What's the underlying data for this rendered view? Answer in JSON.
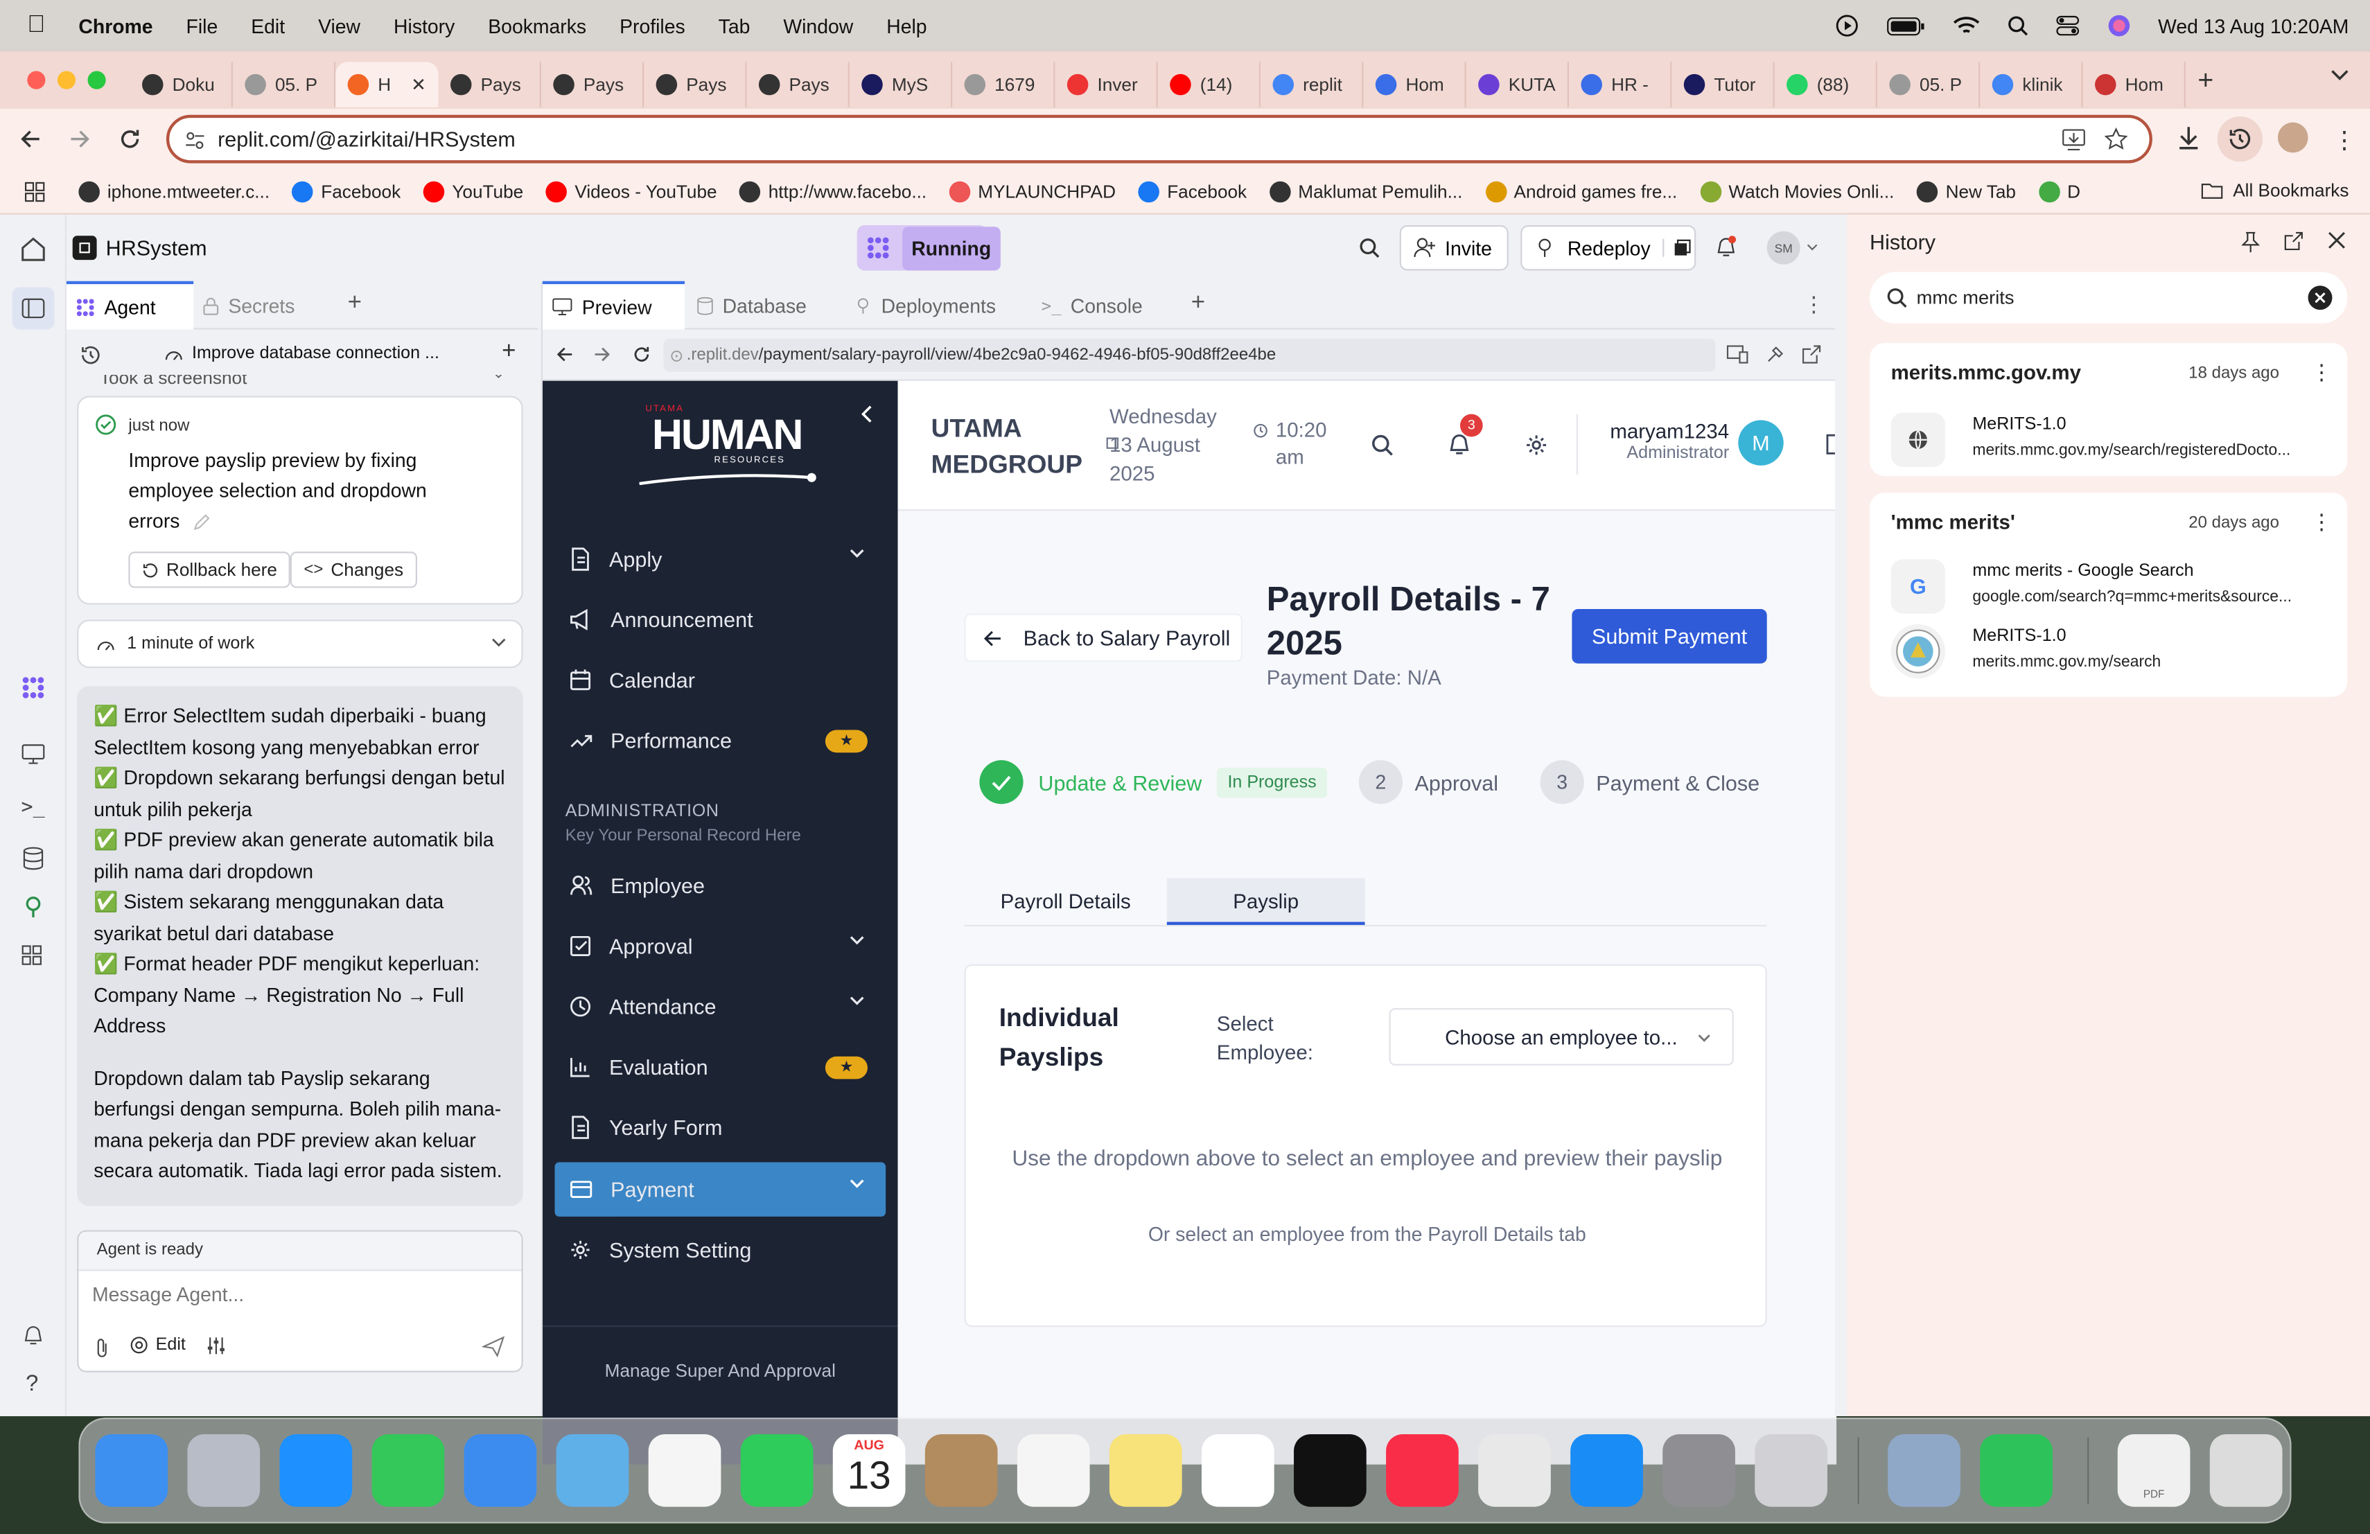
{
  "menubar": {
    "app": "Chrome",
    "items": [
      "File",
      "Edit",
      "View",
      "History",
      "Bookmarks",
      "Profiles",
      "Tab",
      "Window",
      "Help"
    ],
    "datetime": "Wed 13 Aug  10:20AM"
  },
  "tabs": [
    {
      "label": "Doku",
      "color": "#333"
    },
    {
      "label": "05. P",
      "color": "#999"
    },
    {
      "label": "H",
      "color": "#f26522",
      "active": true
    },
    {
      "label": "Pays",
      "color": "#333"
    },
    {
      "label": "Pays",
      "color": "#333"
    },
    {
      "label": "Pays",
      "color": "#333"
    },
    {
      "label": "Pays",
      "color": "#333"
    },
    {
      "label": "MyS",
      "color": "#1a1a5e"
    },
    {
      "label": "1679",
      "color": "#999"
    },
    {
      "label": "Inver",
      "color": "#e33"
    },
    {
      "label": "(14)",
      "color": "#f00"
    },
    {
      "label": "replit",
      "color": "#4285f4"
    },
    {
      "label": "Hom",
      "color": "#3a6ee8"
    },
    {
      "label": "KUTA",
      "color": "#6b3fd6"
    },
    {
      "label": "HR -",
      "color": "#3a6ee8"
    },
    {
      "label": "Tutor",
      "color": "#1a1a5e"
    },
    {
      "label": "(88)",
      "color": "#25d366"
    },
    {
      "label": "05. P",
      "color": "#999"
    },
    {
      "label": "klinik",
      "color": "#4285f4"
    },
    {
      "label": "Hom",
      "color": "#c33"
    }
  ],
  "address": {
    "url": "replit.com/@azirkitai/HRSystem"
  },
  "bookmarks": [
    {
      "label": "iphone.mtweeter.c...",
      "color": "#333"
    },
    {
      "label": "Facebook",
      "color": "#1877f2"
    },
    {
      "label": "YouTube",
      "color": "#f00"
    },
    {
      "label": "Videos - YouTube",
      "color": "#f00"
    },
    {
      "label": "http://www.facebo...",
      "color": "#333"
    },
    {
      "label": "MYLAUNCHPAD",
      "color": "#e55"
    },
    {
      "label": "Facebook",
      "color": "#1877f2"
    },
    {
      "label": "Maklumat Pemulih...",
      "color": "#333"
    },
    {
      "label": "Android games fre...",
      "color": "#d90"
    },
    {
      "label": "Watch Movies Onli...",
      "color": "#8a3"
    },
    {
      "label": "New Tab",
      "color": "#333"
    },
    {
      "label": "D",
      "color": "#4a4"
    }
  ],
  "all_bookmarks": "All Bookmarks",
  "replit": {
    "project": "HRSystem",
    "status": "Running",
    "invite": "Invite",
    "redeploy": "Redeploy",
    "avatar": "SM",
    "agent_tab": "Agent",
    "secrets_tab": "Secrets",
    "thread_title": "Improve database connection ...",
    "screenshot_note": "Took a screenshot",
    "checkpoint": {
      "time": "just now",
      "text": "Improve payslip preview by fixing employee selection and dropdown errors",
      "rollback": "Rollback here",
      "changes": "Changes"
    },
    "work": "1 minute of work",
    "message_lines": [
      "✅ Error SelectItem sudah diperbaiki - buang SelectItem kosong yang menyebabkan error",
      "✅ Dropdown sekarang berfungsi dengan betul untuk pilih pekerja",
      "✅ PDF preview akan generate automatik bila pilih nama dari dropdown",
      "✅ Sistem sekarang menggunakan data syarikat betul dari database",
      "✅ Format header PDF mengikut keperluan: Company Name → Registration No → Full Address"
    ],
    "message_summary": "Dropdown dalam tab Payslip sekarang berfungsi dengan sempurna. Boleh pilih mana-mana pekerja dan PDF preview akan keluar secara automatik. Tiada lagi error pada sistem.",
    "agent_status": "Agent is ready",
    "message_placeholder": "Message Agent...",
    "edit": "Edit",
    "pane_tabs": [
      "Preview",
      "Database",
      "Deployments",
      "Console"
    ],
    "preview_url_prefix": ".replit.dev",
    "preview_url_path": "/payment/salary-payroll/view/4be2c9a0-9462-4946-bf05-90d8ff2ee4be"
  },
  "hr": {
    "logo_small": "UTAMA",
    "logo_main": "HUMAN",
    "logo_sub": "RESOURCES",
    "company_line1": "UTAMA",
    "company_line2": "MEDGROUP",
    "date": "Wednesday 13 August 2025",
    "time": "10:20 am",
    "notif_count": "3",
    "user": "maryam1234",
    "role": "Administrator",
    "user_initial": "M",
    "nav": [
      {
        "label": "Apply"
      },
      {
        "label": "Announcement"
      },
      {
        "label": "Calendar"
      },
      {
        "label": "Performance"
      }
    ],
    "admin_heading": "ADMINISTRATION",
    "admin_sub": "Key Your Personal Record Here",
    "admin_nav": [
      {
        "label": "Employee"
      },
      {
        "label": "Approval"
      },
      {
        "label": "Attendance"
      },
      {
        "label": "Evaluation"
      },
      {
        "label": "Yearly Form"
      },
      {
        "label": "Payment"
      },
      {
        "label": "System Setting"
      }
    ],
    "sidebar_footer": "Manage Super And Approval",
    "back": "Back to Salary Payroll",
    "title": "Payroll Details - 7 2025",
    "payment_date": "Payment Date: N/A",
    "submit": "Submit Payment",
    "steps": [
      {
        "num": "✓",
        "label": "Update & Review",
        "badge": "In Progress"
      },
      {
        "num": "2",
        "label": "Approval"
      },
      {
        "num": "3",
        "label": "Payment & Close"
      }
    ],
    "tabs": [
      "Payroll Details",
      "Payslip"
    ],
    "individual": "Individual Payslips",
    "select_label": "Select Employee:",
    "select_placeholder": "Choose an employee to...",
    "empty_main": "Use the dropdown above to select an employee and preview their payslip",
    "empty_sub": "Or select an employee from the Payroll Details tab"
  },
  "history": {
    "title": "History",
    "search": "mmc merits",
    "groups": [
      {
        "heading": "merits.mmc.gov.my",
        "ago": "18 days ago",
        "items": [
          {
            "title": "MeRITS-1.0",
            "url": "merits.mmc.gov.my/search/registeredDocto..."
          }
        ]
      },
      {
        "heading": "'mmc merits'",
        "ago": "20 days ago",
        "items": [
          {
            "title": "mmc merits - Google Search",
            "url": "google.com/search?q=mmc+merits&source..."
          },
          {
            "title": "MeRITS-1.0",
            "url": "merits.mmc.gov.my/search"
          }
        ]
      }
    ]
  },
  "dock": {
    "calendar_month": "AUG",
    "calendar_day": "13",
    "apps": [
      {
        "name": "finder-icon",
        "color": "#3d8ff0"
      },
      {
        "name": "launchpad-icon",
        "color": "#b8bcc6"
      },
      {
        "name": "safari-icon",
        "color": "#1e90ff"
      },
      {
        "name": "messages-icon",
        "color": "#34c759"
      },
      {
        "name": "mail-icon",
        "color": "#3c8cf0"
      },
      {
        "name": "maps-icon",
        "color": "#5fb0e8"
      },
      {
        "name": "photos-icon",
        "color": "#f5f5f5"
      },
      {
        "name": "facetime-icon",
        "color": "#2ecc5a"
      },
      {
        "name": "calendar-icon",
        "color": "#ffffff"
      },
      {
        "name": "contacts-icon",
        "color": "#b28b5e"
      },
      {
        "name": "reminders-icon",
        "color": "#f5f5f5"
      },
      {
        "name": "notes-icon",
        "color": "#f8e27a"
      },
      {
        "name": "freeform-icon",
        "color": "#ffffff"
      },
      {
        "name": "tv-icon",
        "color": "#111111"
      },
      {
        "name": "music-icon",
        "color": "#fa2d48"
      },
      {
        "name": "chrome-icon",
        "color": "#e8e8e8"
      },
      {
        "name": "appstore-icon",
        "color": "#1a8cf5"
      },
      {
        "name": "settings-icon",
        "color": "#8e8e93"
      },
      {
        "name": "iphone-mirroring-icon",
        "color": "#d0d0d5"
      },
      {
        "name": "preview-icon",
        "color": "#8fa8c8"
      },
      {
        "name": "numbers-icon",
        "color": "#2ec25a"
      },
      {
        "name": "pdf-file-icon",
        "color": "#f0f0f0"
      },
      {
        "name": "trash-icon",
        "color": "#dcdcdc"
      }
    ],
    "pdf_label": "PDF"
  }
}
